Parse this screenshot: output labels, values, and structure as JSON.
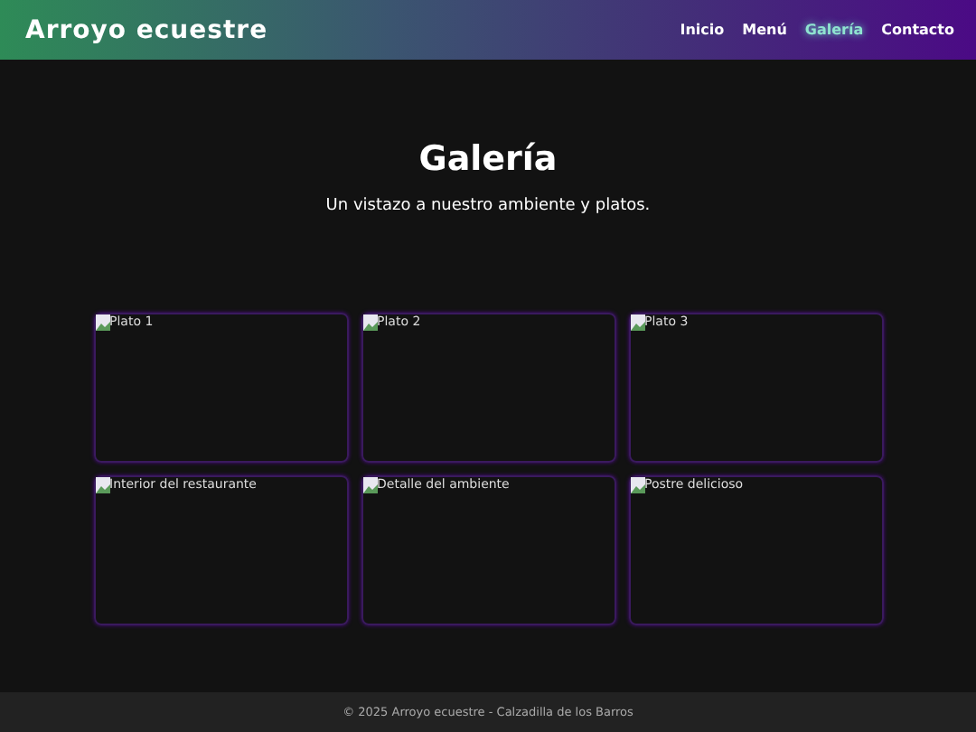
{
  "header": {
    "title": "Arroyo ecuestre",
    "nav": [
      {
        "label": "Inicio",
        "selected": false
      },
      {
        "label": "Menú",
        "selected": false
      },
      {
        "label": "Galería",
        "selected": true
      },
      {
        "label": "Contacto",
        "selected": false
      }
    ]
  },
  "gallery": {
    "title": "Galería",
    "subtitle": "Un vistazo a nuestro ambiente y platos.",
    "images": [
      {
        "alt": "Plato 1"
      },
      {
        "alt": "Plato 2"
      },
      {
        "alt": "Plato 3"
      },
      {
        "alt": "Interior del restaurante"
      },
      {
        "alt": "Detalle del ambiente"
      },
      {
        "alt": "Postre delicioso"
      }
    ]
  },
  "footer": {
    "text": "© 2025 Arroyo ecuestre - Calzadilla de los Barros"
  }
}
